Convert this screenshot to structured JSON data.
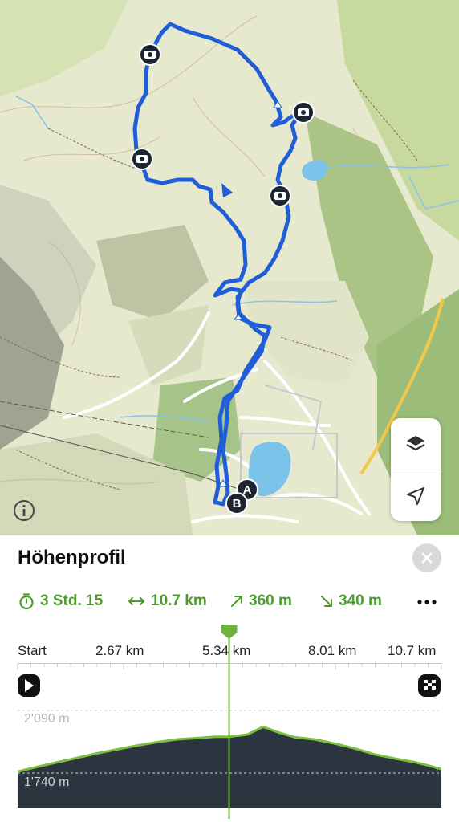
{
  "map": {
    "icons": {
      "layers": "layers-icon",
      "locate": "location-arrow-icon",
      "info": "info-icon",
      "photo": "camera-icon"
    },
    "markers": {
      "start": "A",
      "end": "B"
    },
    "colors": {
      "route": "#1f5ed8",
      "road_yellow": "#f2c84a"
    }
  },
  "panel": {
    "title": "Höhenprofil",
    "stats": {
      "duration": "3 Std. 15",
      "distance": "10.7 km",
      "ascent": "360 m",
      "descent": "340 m"
    },
    "axis_labels": [
      "Start",
      "2.67 km",
      "5.34 km",
      "8.01 km",
      "10.7 km"
    ],
    "elevation_labels": {
      "upper": "2'090 m",
      "lower": "1'740 m"
    },
    "colors": {
      "accent": "#4d9a2e",
      "profile_fill": "#2c3440"
    }
  },
  "chart_data": {
    "type": "area",
    "x_unit": "km",
    "y_unit": "m",
    "ylim": [
      1740,
      2090
    ],
    "x": [
      0,
      0.5,
      1,
      1.5,
      2,
      2.5,
      3,
      3.5,
      4,
      4.5,
      5,
      5.34,
      5.8,
      6.2,
      6.6,
      7,
      7.5,
      8,
      8.5,
      9,
      9.5,
      10,
      10.3,
      10.7
    ],
    "y": [
      1748,
      1775,
      1800,
      1825,
      1850,
      1872,
      1893,
      1912,
      1928,
      1935,
      1943,
      1943,
      1955,
      1998,
      1966,
      1940,
      1928,
      1905,
      1878,
      1845,
      1822,
      1802,
      1786,
      1762
    ],
    "position_marker_km": 5.34
  }
}
